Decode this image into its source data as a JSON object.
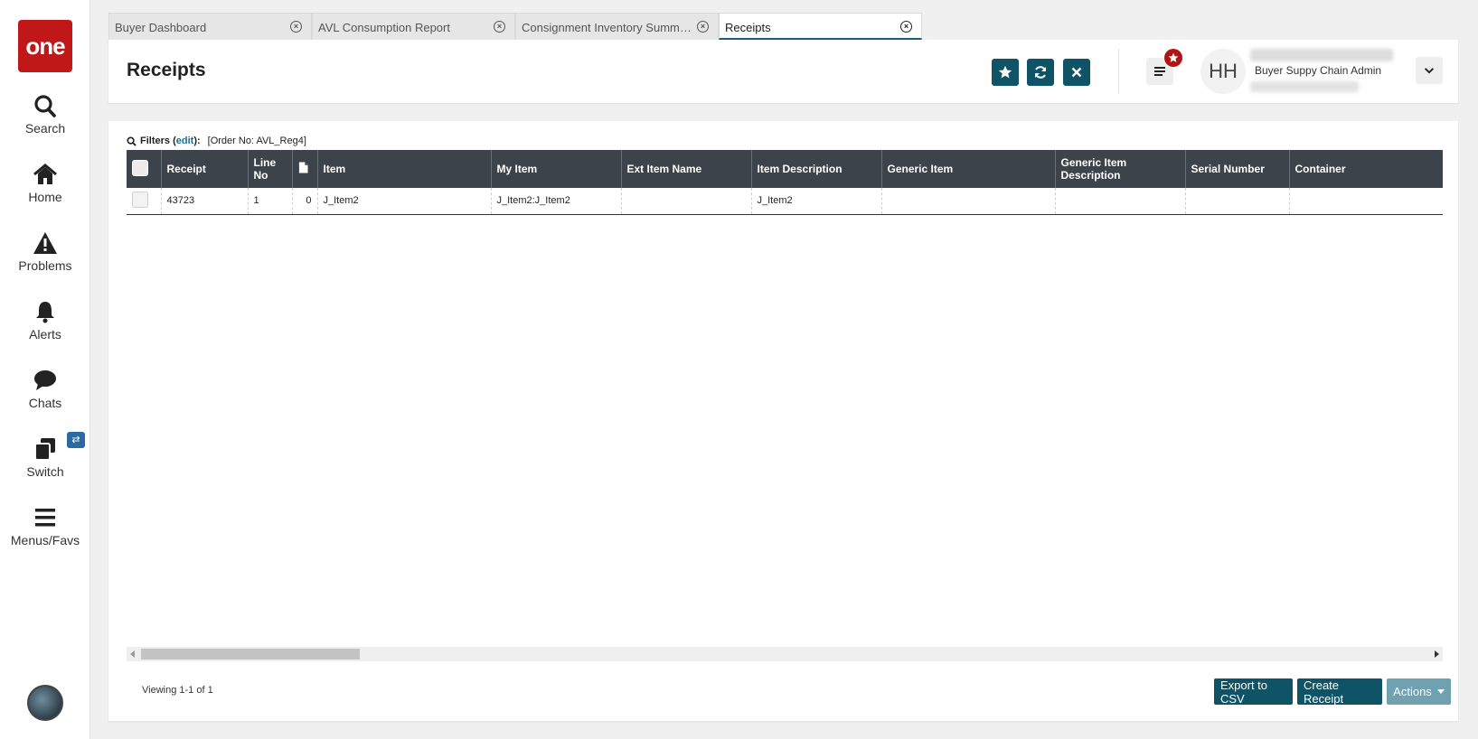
{
  "app": {
    "logo_text": "one"
  },
  "sidebar": {
    "items": [
      {
        "label": "Search",
        "icon": "search-icon"
      },
      {
        "label": "Home",
        "icon": "home-icon"
      },
      {
        "label": "Problems",
        "icon": "warning-icon"
      },
      {
        "label": "Alerts",
        "icon": "bell-icon"
      },
      {
        "label": "Chats",
        "icon": "chat-icon"
      },
      {
        "label": "Switch",
        "icon": "switch-icon"
      },
      {
        "label": "Menus/Favs",
        "icon": "menu-icon"
      }
    ]
  },
  "tabs": [
    {
      "label": "Buyer Dashboard",
      "active": false
    },
    {
      "label": "AVL Consumption Report",
      "active": false
    },
    {
      "label": "Consignment Inventory Summar...",
      "active": false
    },
    {
      "label": "Receipts",
      "active": true
    }
  ],
  "header": {
    "title": "Receipts",
    "user_initials": "HH",
    "user_role": "Buyer Suppy Chain Admin"
  },
  "filters": {
    "title": "Filters",
    "edit_label": "edit",
    "value": "[Order No: AVL_Reg4]"
  },
  "table": {
    "columns": [
      "Receipt",
      "Line No",
      "",
      "Item",
      "My Item",
      "Ext Item Name",
      "Item Description",
      "Generic Item",
      "Generic Item Description",
      "Serial Number",
      "Container"
    ],
    "rows": [
      {
        "receipt": "43723",
        "line_no": "1",
        "attachments": "0",
        "item": "J_Item2",
        "my_item": "J_Item2:J_Item2",
        "ext_item_name": "",
        "item_description": "J_Item2",
        "generic_item": "",
        "generic_item_description": "",
        "serial_number": "",
        "container": ""
      }
    ]
  },
  "footer": {
    "viewing": "Viewing 1-1 of 1",
    "export_label": "Export to CSV",
    "create_label": "Create Receipt",
    "actions_label": "Actions"
  },
  "colors": {
    "accent": "#0e5366",
    "brand_red": "#c01818",
    "header_row": "#3d434b",
    "link": "#1b6f8a"
  }
}
